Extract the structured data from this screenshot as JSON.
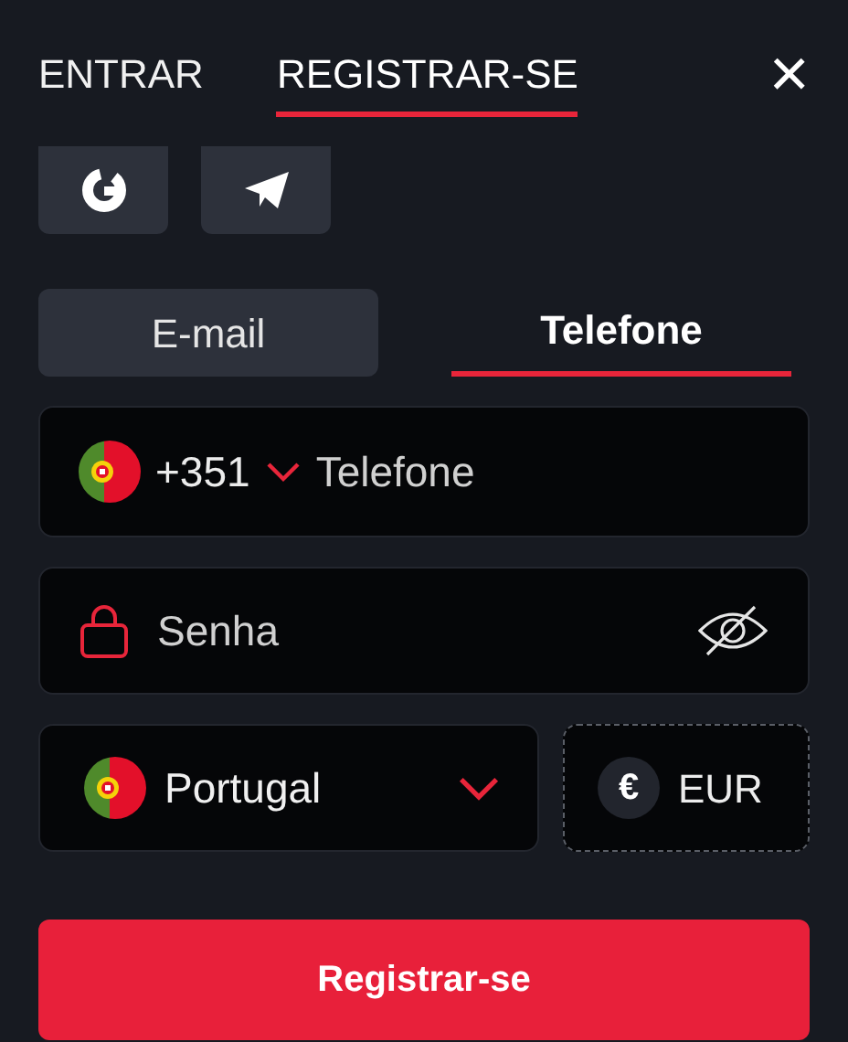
{
  "tabs": [
    {
      "label": "ENTRAR",
      "selected": false
    },
    {
      "label": "REGISTRAR-SE",
      "selected": true
    }
  ],
  "close": "×",
  "method_tabs": [
    {
      "label": "E-mail",
      "selected": false
    },
    {
      "label": "Telefone",
      "selected": true
    }
  ],
  "phone": {
    "code": "+351",
    "placeholder": "Telefone"
  },
  "password": {
    "placeholder": "Senha"
  },
  "country": {
    "value": "Portugal"
  },
  "currency": {
    "symbol": "€",
    "value": "EUR"
  },
  "submit": "Registrar-se"
}
